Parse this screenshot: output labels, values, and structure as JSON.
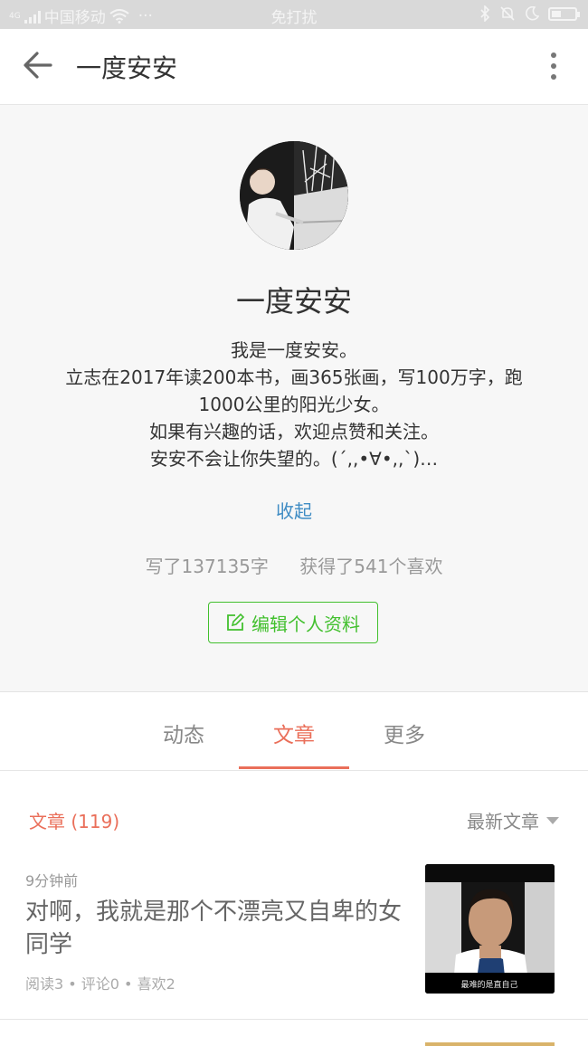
{
  "status_bar": {
    "network_type": "4G",
    "carrier": "中国移动",
    "extra": "···",
    "mode": "免打扰",
    "icons": [
      "signal-icon",
      "wifi-icon",
      "bluetooth-icon",
      "mute-bell-icon",
      "moon-icon",
      "battery-icon"
    ]
  },
  "header": {
    "title": "一度安安",
    "back_icon": "arrow-left-icon",
    "menu_icon": "more-vertical-icon"
  },
  "profile": {
    "name": "一度安安",
    "bio": [
      "我是一度安安。",
      "立志在2017年读200本书，画365张画，写100万字，跑1000公里的阳光少女。",
      "如果有兴趣的话，欢迎点赞和关注。",
      "安安不会让你失望的。(´,,•∀•,,`)…"
    ],
    "collapse_label": "收起",
    "words_written": "写了137135字",
    "likes_received": "获得了541个喜欢",
    "edit_button_label": "编辑个人资料",
    "accent_color": "#42c02e"
  },
  "tabs": {
    "items": [
      {
        "label": "动态",
        "active": false
      },
      {
        "label": "文章",
        "active": true
      },
      {
        "label": "更多",
        "active": false
      }
    ],
    "active_color": "#ea6f5a"
  },
  "articles": {
    "count_label": "文章 (119)",
    "sort_label": "最新文章",
    "items": [
      {
        "time": "9分钟前",
        "title": "对啊，我就是那个不漂亮又自卑的女同学",
        "meta": "阅读3 • 评论0 • 喜欢2",
        "thumbnail_caption": "最难的是直自己"
      }
    ]
  }
}
